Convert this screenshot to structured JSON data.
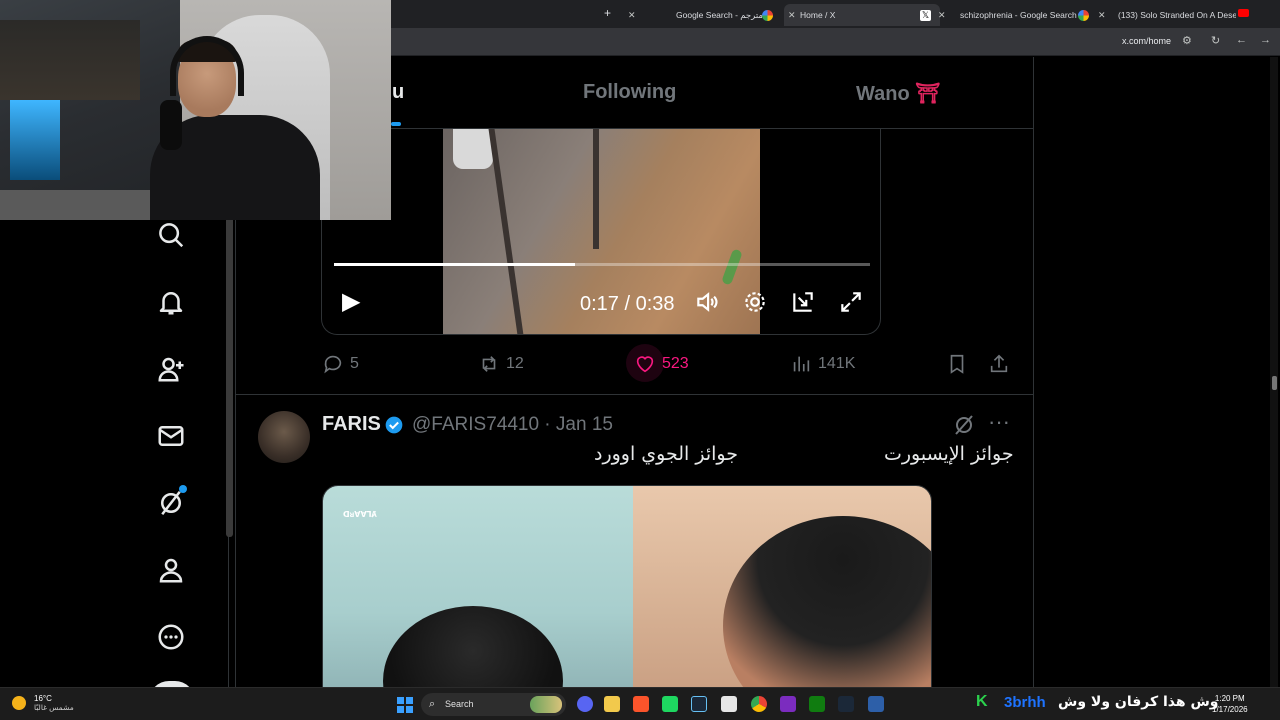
{
  "browser": {
    "tabs": [
      {
        "title": "Google Search - مترجم",
        "favicon": "google-icon"
      },
      {
        "title": "Home / X",
        "favicon": "x-icon",
        "active": true
      },
      {
        "title": "schizophrenia - Google Search",
        "favicon": "google-icon"
      },
      {
        "title": "(133) Solo Stranded On A Dese",
        "favicon": "youtube-icon"
      }
    ],
    "new_tab": "+",
    "url": "x.com/home"
  },
  "feed_tabs": {
    "for_you_partial": "u",
    "following": "Following",
    "wano": "Wano",
    "wano_emoji": "⛩"
  },
  "video": {
    "time": "0:17 / 0:38",
    "progress": 0.45
  },
  "tweet1_actions": {
    "replies": "5",
    "reposts": "12",
    "likes": "523",
    "views": "141K"
  },
  "tweet2": {
    "name": "FARIS",
    "handle": "@FARIS74410 · Jan 15",
    "text_right": "جوائز الإيسبورت",
    "text_left": "جوائز الجوي اوورد",
    "watermark": "ᗡᴚꓯⱯ⅂Ⱥ"
  },
  "taskbar": {
    "temp": "16°C",
    "weather_desc": "مشمس غالبًا",
    "search": "Search",
    "tray_k": "K",
    "tray_name": "3brhh",
    "tray_arabic": "وش هذا كرفان ولا وش",
    "time": "1:20 PM",
    "date": "1/17/2026"
  },
  "colors": {
    "accent": "#1d9bf0",
    "like": "#f91880",
    "muted": "#71767b"
  }
}
